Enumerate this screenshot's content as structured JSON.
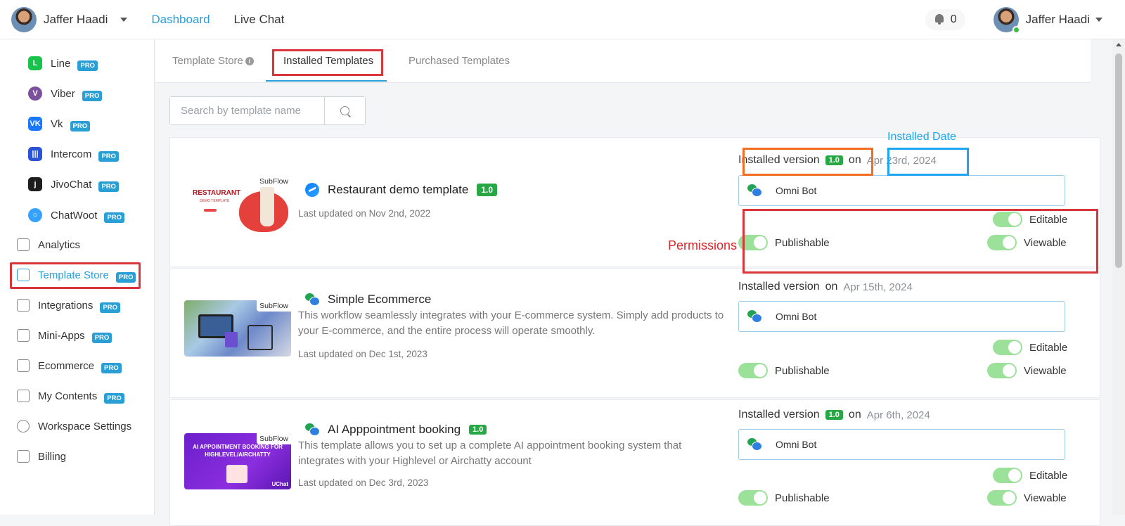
{
  "header": {
    "user_name": "Jaffer Haadi",
    "nav": [
      "Dashboard",
      "Live Chat"
    ],
    "notification_count": "0",
    "right_user_name": "Jaffer Haadi"
  },
  "sidebar": {
    "pro_badge": "PRO",
    "sub_items": [
      {
        "label": "Line",
        "icon": "line-icon",
        "glyph": "L"
      },
      {
        "label": "Viber",
        "icon": "viber-icon",
        "glyph": "V"
      },
      {
        "label": "Vk",
        "icon": "vk-icon",
        "glyph": "VK"
      },
      {
        "label": "Intercom",
        "icon": "intercom-icon",
        "glyph": "|||"
      },
      {
        "label": "JivoChat",
        "icon": "jivochat-icon",
        "glyph": "j"
      },
      {
        "label": "ChatWoot",
        "icon": "chatwoot-icon",
        "glyph": "○"
      }
    ],
    "main_items": [
      {
        "label": "Analytics",
        "icon": "analytics-icon",
        "pro": false
      },
      {
        "label": "Template Store",
        "icon": "template-store-icon",
        "pro": true
      },
      {
        "label": "Integrations",
        "icon": "integrations-icon",
        "pro": true
      },
      {
        "label": "Mini-Apps",
        "icon": "mini-apps-icon",
        "pro": true
      },
      {
        "label": "Ecommerce",
        "icon": "ecommerce-icon",
        "pro": true
      },
      {
        "label": "My Contents",
        "icon": "my-contents-icon",
        "pro": true
      },
      {
        "label": "Workspace Settings",
        "icon": "workspace-settings-icon",
        "pro": false
      },
      {
        "label": "Billing",
        "icon": "billing-icon",
        "pro": false
      }
    ]
  },
  "tabs": {
    "store": "Template Store",
    "installed": "Installed Templates",
    "purchased": "Purchased Templates"
  },
  "search": {
    "placeholder": "Search by template name"
  },
  "labels": {
    "installed_version": "Installed version",
    "on": "on",
    "subflow": "SubFlow",
    "last_updated_prefix": "Last updated on",
    "editable": "Editable",
    "publishable": "Publishable",
    "viewable": "Viewable"
  },
  "templates": [
    {
      "title": "Restaurant demo template",
      "version": "1.0",
      "channel_icon": "messenger-icon",
      "description": "",
      "last_updated": "Last updated on Nov 2nd, 2022",
      "installed_version": "1.0",
      "installed_date": "Apr 23rd, 2024",
      "bot": "Omni Bot",
      "permissions": {
        "editable": true,
        "publishable": true,
        "viewable": true
      }
    },
    {
      "title": "Simple Ecommerce",
      "version": "",
      "channel_icon": "omni-channel-icon",
      "description": "This workflow seamlessly integrates with your E-commerce system. Simply add products to your E-commerce, and the entire process will operate smoothly.",
      "last_updated": "Last updated on Dec 1st, 2023",
      "installed_version": "",
      "installed_date": "Apr 15th, 2024",
      "bot": "Omni Bot",
      "permissions": {
        "editable": true,
        "publishable": true,
        "viewable": true
      }
    },
    {
      "title": "AI Apppointment booking",
      "version": "1.0",
      "channel_icon": "omni-channel-icon",
      "description": "This template allows you to set up a complete AI appointment booking system that integrates with your Highlevel or Airchatty account",
      "last_updated": "Last updated on Dec 3rd, 2023",
      "installed_version": "1.0",
      "installed_date": "Apr 6th, 2024",
      "bot": "Omni Bot",
      "permissions": {
        "editable": true,
        "publishable": true,
        "viewable": true
      }
    }
  ],
  "thumbnails": {
    "restaurant_title": "RESTAURANT",
    "restaurant_sub": "DEMO TEMPLATE",
    "ai_title": "AI APPOINTMENT BOOKING FOR HIGHLEVEL/AIRCHATTY",
    "ai_logo": "UChat"
  },
  "annotations": {
    "installed_date": "Installed Date",
    "permissions": "Permissions"
  },
  "colors": {
    "accent": "#2a9fd6",
    "version_badge": "#28a745",
    "toggle_on": "#9be19a",
    "annotation_red": "#d9353a",
    "annotation_orange": "#f36c21",
    "annotation_blue": "#1ea5f0"
  }
}
